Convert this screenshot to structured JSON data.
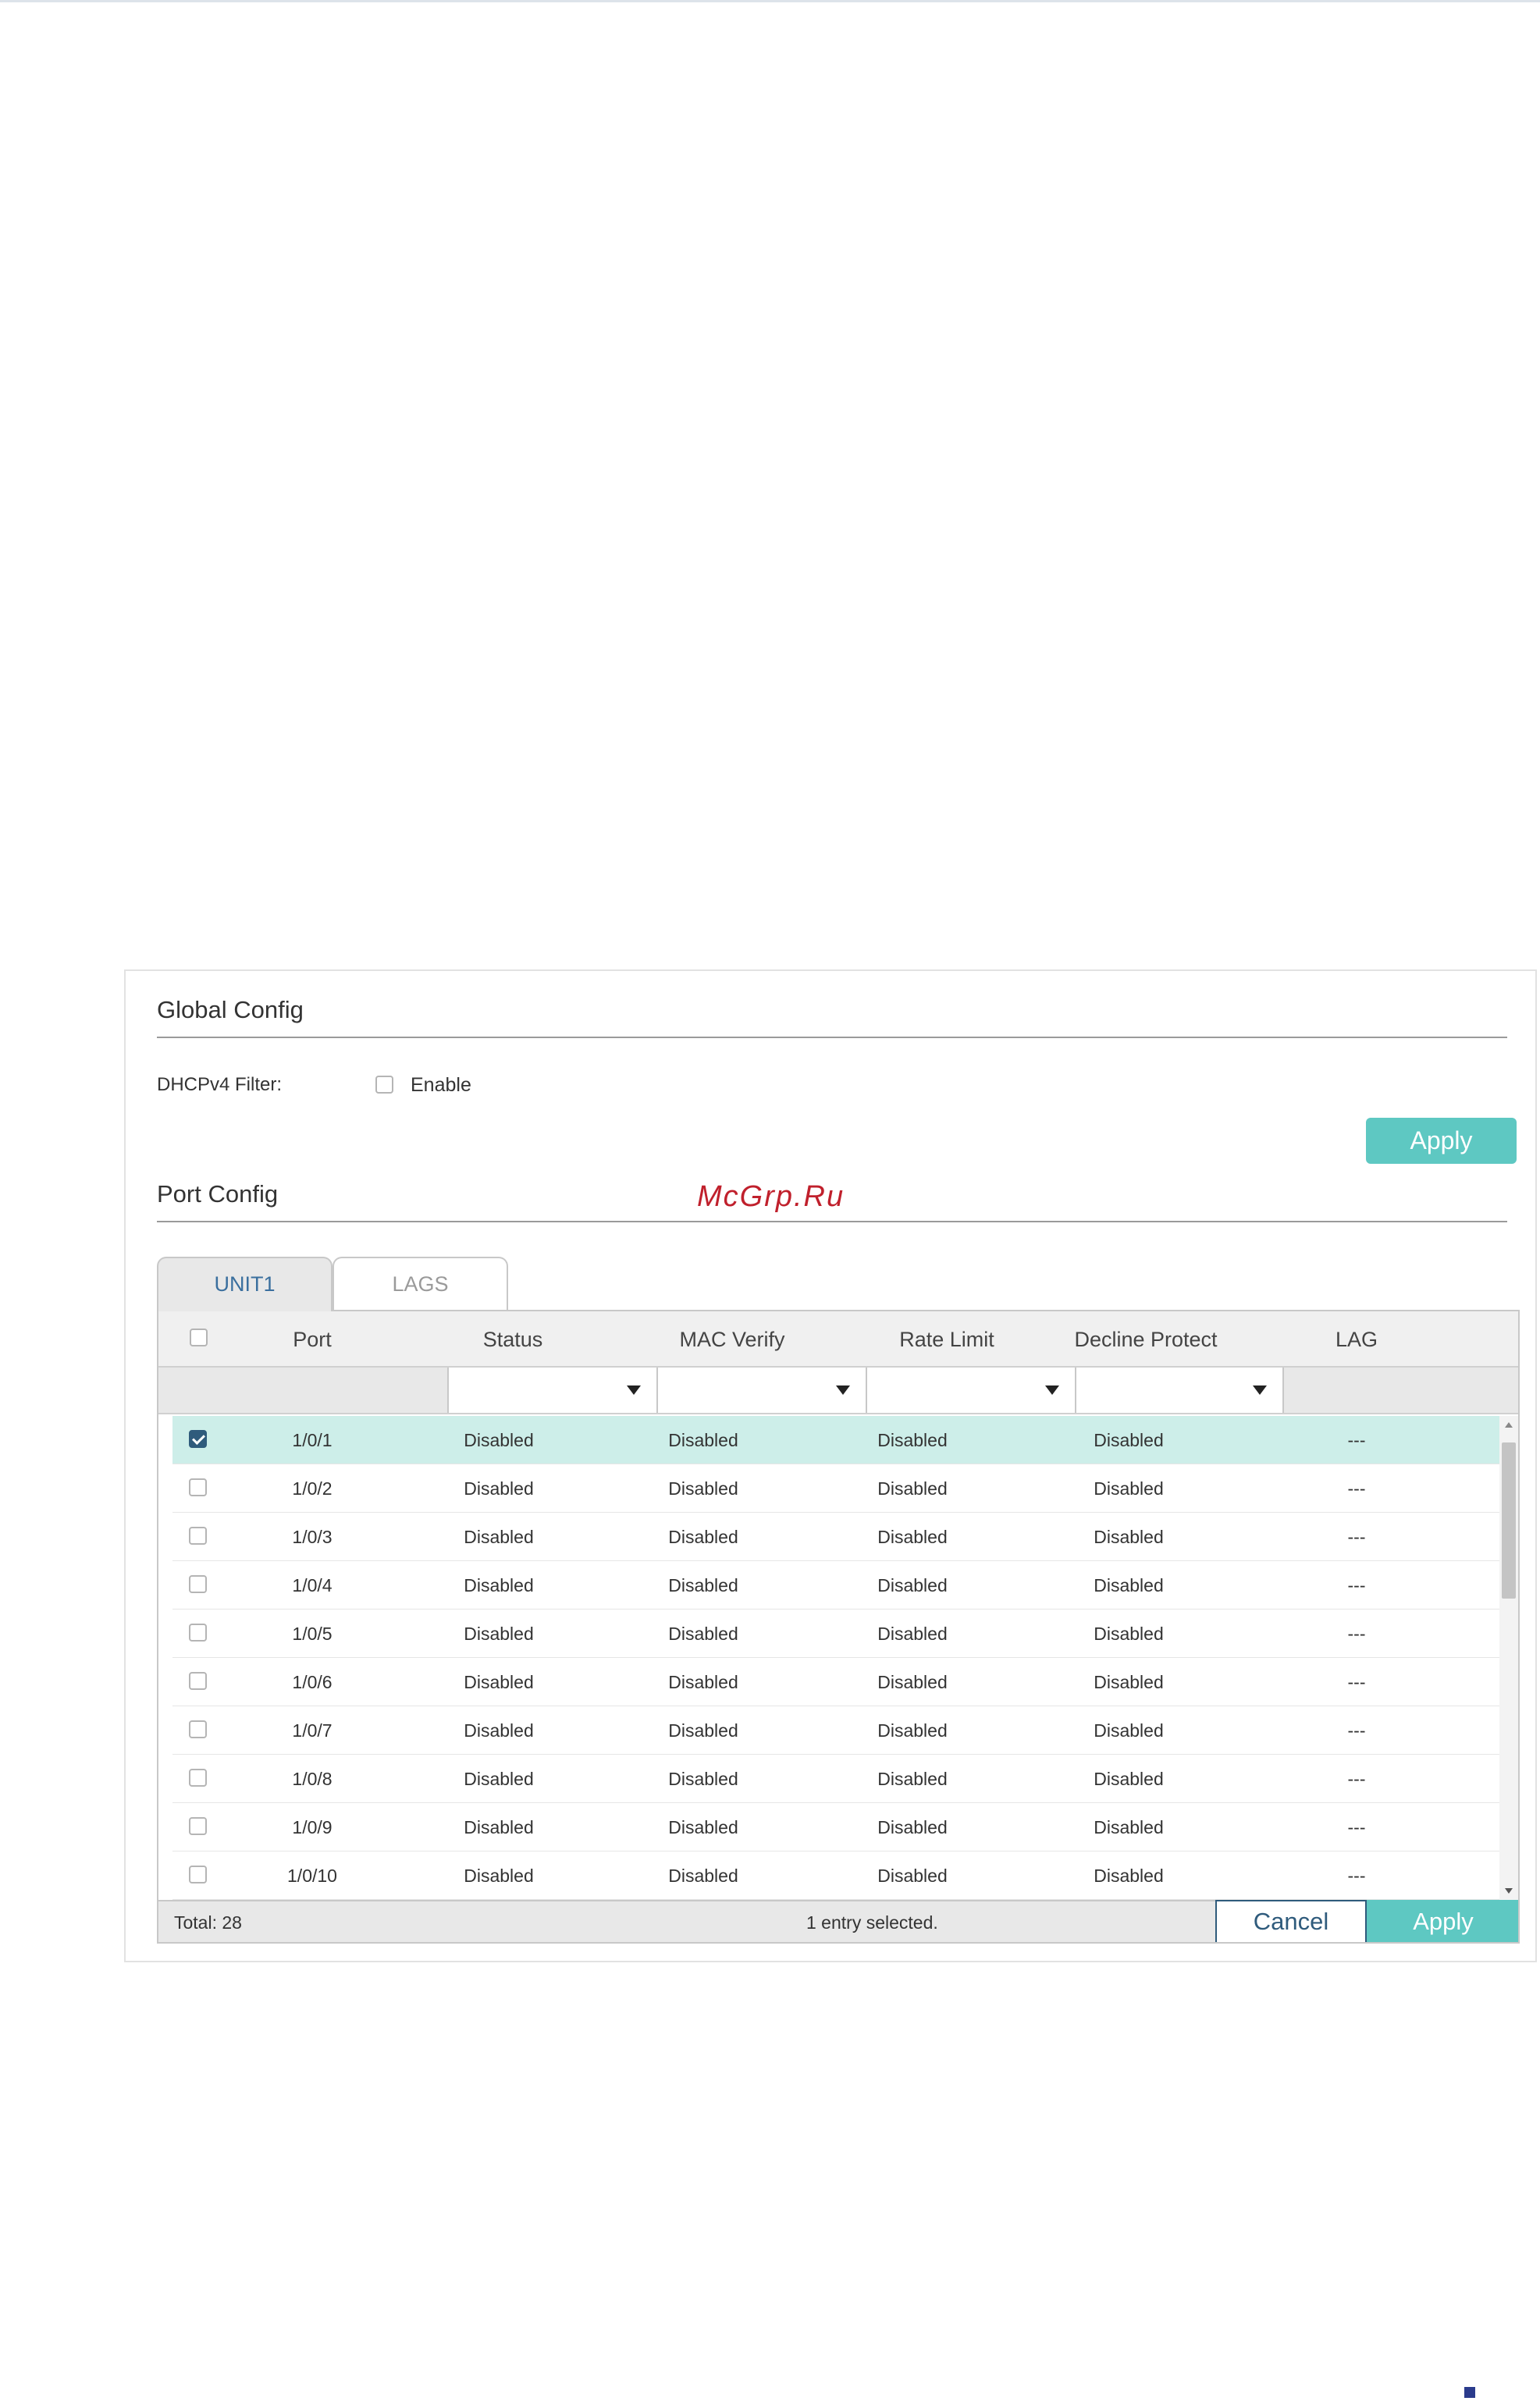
{
  "watermark": "McGrp.Ru",
  "global_config": {
    "title": "Global Config",
    "dhcpv4_filter_label": "DHCPv4 Filter:",
    "enable_label": "Enable",
    "enable_checked": false,
    "apply_label": "Apply"
  },
  "port_config": {
    "title": "Port Config",
    "tabs": [
      {
        "label": "UNIT1",
        "active": true
      },
      {
        "label": "LAGS",
        "active": false
      }
    ],
    "columns": [
      "Port",
      "Status",
      "MAC Verify",
      "Rate Limit",
      "Decline Protect",
      "LAG"
    ],
    "rows": [
      {
        "port": "1/0/1",
        "status": "Disabled",
        "mac_verify": "Disabled",
        "rate_limit": "Disabled",
        "decline_protect": "Disabled",
        "lag": "---",
        "checked": true
      },
      {
        "port": "1/0/2",
        "status": "Disabled",
        "mac_verify": "Disabled",
        "rate_limit": "Disabled",
        "decline_protect": "Disabled",
        "lag": "---",
        "checked": false
      },
      {
        "port": "1/0/3",
        "status": "Disabled",
        "mac_verify": "Disabled",
        "rate_limit": "Disabled",
        "decline_protect": "Disabled",
        "lag": "---",
        "checked": false
      },
      {
        "port": "1/0/4",
        "status": "Disabled",
        "mac_verify": "Disabled",
        "rate_limit": "Disabled",
        "decline_protect": "Disabled",
        "lag": "---",
        "checked": false
      },
      {
        "port": "1/0/5",
        "status": "Disabled",
        "mac_verify": "Disabled",
        "rate_limit": "Disabled",
        "decline_protect": "Disabled",
        "lag": "---",
        "checked": false
      },
      {
        "port": "1/0/6",
        "status": "Disabled",
        "mac_verify": "Disabled",
        "rate_limit": "Disabled",
        "decline_protect": "Disabled",
        "lag": "---",
        "checked": false
      },
      {
        "port": "1/0/7",
        "status": "Disabled",
        "mac_verify": "Disabled",
        "rate_limit": "Disabled",
        "decline_protect": "Disabled",
        "lag": "---",
        "checked": false
      },
      {
        "port": "1/0/8",
        "status": "Disabled",
        "mac_verify": "Disabled",
        "rate_limit": "Disabled",
        "decline_protect": "Disabled",
        "lag": "---",
        "checked": false
      },
      {
        "port": "1/0/9",
        "status": "Disabled",
        "mac_verify": "Disabled",
        "rate_limit": "Disabled",
        "decline_protect": "Disabled",
        "lag": "---",
        "checked": false
      },
      {
        "port": "1/0/10",
        "status": "Disabled",
        "mac_verify": "Disabled",
        "rate_limit": "Disabled",
        "decline_protect": "Disabled",
        "lag": "---",
        "checked": false
      }
    ],
    "total": "Total: 28",
    "selection_info": "1 entry selected.",
    "cancel_label": "Cancel",
    "apply_label": "Apply"
  },
  "colors": {
    "accent_teal": "#5ec8c2",
    "selected_row": "#cdeee9",
    "dark_blue": "#2f5b7c",
    "watermark": "#c0202c"
  }
}
